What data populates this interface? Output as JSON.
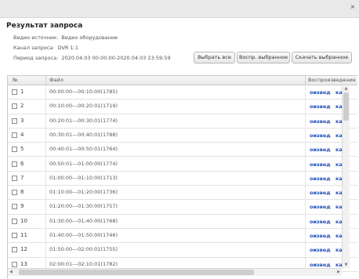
{
  "window": {
    "close_glyph": "×"
  },
  "dialog": {
    "title": "Результат запроса",
    "video_source_label": "Видео источник:",
    "video_source_value": "Видео оборудование",
    "channel_label": "Канал запроса:",
    "channel_value": "DVR 1:1",
    "period_label": "Период запроса:",
    "period_value": "2020.04.03 00:00:00-2020.04.03 23:59:59"
  },
  "buttons": {
    "select_all": "Выбрать все",
    "play_selected": "Воспр. выбранное",
    "download_selected": "Скачать выбранное"
  },
  "table": {
    "columns": {
      "num": "№",
      "file": "Файл",
      "playback": "Воспроизведение"
    },
    "action_play": "оизвед",
    "action_download": "кача",
    "rows": [
      {
        "num": "1",
        "file": "00:00:00---00:10:00(1785)"
      },
      {
        "num": "2",
        "file": "00:10:00---00:20:01(1719)"
      },
      {
        "num": "3",
        "file": "00:20:01---00:30:01(1774)"
      },
      {
        "num": "4",
        "file": "00:30:01---00:40:01(1788)"
      },
      {
        "num": "5",
        "file": "00:40:01---00:50:01(1764)"
      },
      {
        "num": "6",
        "file": "00:50:01---01:00:00(1774)"
      },
      {
        "num": "7",
        "file": "01:00:00---01:10:00(1713)"
      },
      {
        "num": "8",
        "file": "01:10:00---01:20:00(1736)"
      },
      {
        "num": "9",
        "file": "01:20:00---01:30:00(1757)"
      },
      {
        "num": "10",
        "file": "01:30:00---01:40:00(1768)"
      },
      {
        "num": "11",
        "file": "01:40:00---01:50:00(1746)"
      },
      {
        "num": "12",
        "file": "01:50:00---02:00:01(1755)"
      },
      {
        "num": "13",
        "file": "02:00:01---02:10:01(1782)"
      }
    ]
  },
  "icons": {
    "scroll_up": "▲",
    "scroll_down": "▼",
    "scroll_left": "◀",
    "scroll_right": "▶"
  }
}
